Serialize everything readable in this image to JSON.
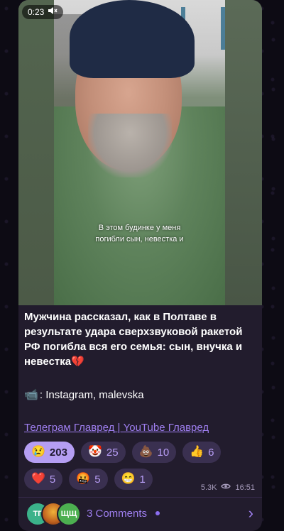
{
  "video": {
    "duration": "0:23",
    "subtitle": "В этом будинке у меня\nпогибли сын, невестка и",
    "sound_icon": "speaker-muted-icon"
  },
  "post": {
    "caption": "Мужчина рассказал, как в Полтаве в результате удара сверхзвуковой ракетой РФ погибла вся его семья: сын, внучка и невестка💔",
    "source_icon": "📹",
    "source": ": Instagram, malevska",
    "link_telegram": "Телеграм Главред",
    "link_sep": " | ",
    "link_youtube": "YouTube Главред"
  },
  "reactions": [
    {
      "emoji": "😢",
      "count": "203",
      "active": true
    },
    {
      "emoji": "🤡",
      "count": "25"
    },
    {
      "emoji": "💩",
      "count": "10"
    },
    {
      "emoji": "👍",
      "count": "6"
    },
    {
      "emoji": "❤️",
      "count": "5"
    },
    {
      "emoji": "🤬",
      "count": "5"
    },
    {
      "emoji": "😁",
      "count": "1"
    }
  ],
  "meta": {
    "views": "5.3K",
    "time": "16:51",
    "views_icon": "eye-icon"
  },
  "comments": {
    "label": "3 Comments",
    "avatars": [
      {
        "initials": "ТГ",
        "color": "#3bb28a"
      },
      {
        "initials": "",
        "color": "#c0621f"
      },
      {
        "initials": "ЩЩ",
        "color": "#4caf50"
      }
    ]
  },
  "colors": {
    "accent": "#9f7ff0",
    "card": "#221c2d"
  }
}
